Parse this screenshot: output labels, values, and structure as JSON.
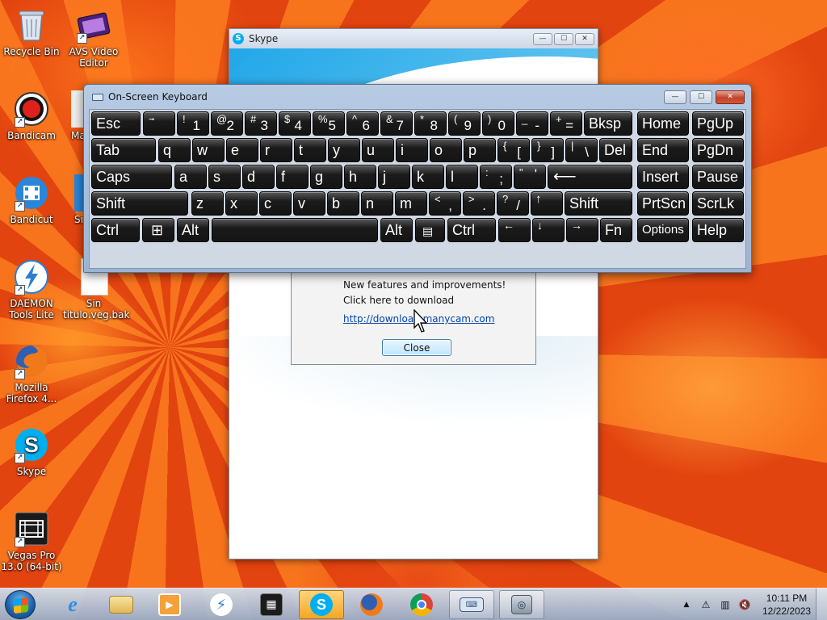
{
  "desktop": {
    "icons": [
      {
        "label": "Recycle Bin",
        "icon": "recycle-bin-icon"
      },
      {
        "label": "AVS Video Editor",
        "icon": "avs-video-editor-icon"
      },
      {
        "label": "Bandicam",
        "icon": "bandicam-icon"
      },
      {
        "label": "Ma",
        "icon": "partial-app-icon"
      },
      {
        "label": "Bandicut",
        "icon": "bandicut-icon"
      },
      {
        "label": "Si",
        "icon": "partial-app-icon"
      },
      {
        "label": "DAEMON Tools Lite",
        "icon": "daemon-tools-icon"
      },
      {
        "label": "Sin titulo.veg.bak",
        "icon": "file-icon"
      },
      {
        "label": "Mozilla Firefox 4...",
        "icon": "firefox-icon"
      },
      {
        "label": "Skype",
        "icon": "skype-icon"
      },
      {
        "label": "Vegas Pro 13.0 (64-bit)",
        "icon": "vegas-pro-icon"
      }
    ]
  },
  "skype_window": {
    "title": "Skype",
    "min": "—",
    "max": "☐",
    "close": "✕"
  },
  "notice": {
    "line1": "New features and improvements!",
    "line2": "Click here to download",
    "link": "http://download.manycam.com",
    "close_label": "Close"
  },
  "osk": {
    "title": "On-Screen Keyboard",
    "min": "—",
    "max": "☐",
    "close": "✕",
    "keys": {
      "esc": "Esc",
      "tilde_s": "~",
      "tilde_m": "`",
      "k1_s": "!",
      "k1_m": "1",
      "k2_s": "@",
      "k2_m": "2",
      "k3_s": "#",
      "k3_m": "3",
      "k4_s": "$",
      "k4_m": "4",
      "k5_s": "%",
      "k5_m": "5",
      "k6_s": "^",
      "k6_m": "6",
      "k7_s": "&",
      "k7_m": "7",
      "k8_s": "*",
      "k8_m": "8",
      "k9_s": "(",
      "k9_m": "9",
      "k0_s": ")",
      "k0_m": "0",
      "minus_s": "_",
      "minus_m": "-",
      "eq_s": "+",
      "eq_m": "=",
      "bksp": "Bksp",
      "home": "Home",
      "pgup": "PgUp",
      "tab": "Tab",
      "q": "q",
      "w": "w",
      "e": "e",
      "r": "r",
      "t": "t",
      "y": "y",
      "u": "u",
      "i": "i",
      "o": "o",
      "p": "p",
      "lbr_s": "{",
      "lbr_m": "[",
      "rbr_s": "}",
      "rbr_m": "]",
      "bsl_s": "|",
      "bsl_m": "\\",
      "del": "Del",
      "end": "End",
      "pgdn": "PgDn",
      "caps": "Caps",
      "a": "a",
      "s": "s",
      "d": "d",
      "f": "f",
      "g": "g",
      "h": "h",
      "j": "j",
      "k": "k",
      "l": "l",
      "semi_s": ":",
      "semi_m": ";",
      "quote_s": "\"",
      "quote_m": "'",
      "enter": "⟵",
      "insert": "Insert",
      "pause": "Pause",
      "shift": "Shift",
      "z": "z",
      "x": "x",
      "c": "c",
      "v": "v",
      "b": "b",
      "n": "n",
      "m": "m",
      "comma_s": "<",
      "comma_m": ",",
      "dot_s": ">",
      "dot_m": ".",
      "slash_s": "?",
      "slash_m": "/",
      "up": "↑",
      "shift_r": "Shift",
      "prtscn": "PrtScn",
      "scrlk": "ScrLk",
      "ctrl": "Ctrl",
      "win": "⊞",
      "alt": "Alt",
      "space": "",
      "alt_r": "Alt",
      "menu": "▤",
      "ctrl_r": "Ctrl",
      "left": "←",
      "down": "↓",
      "right": "→",
      "fn": "Fn",
      "options": "Options",
      "help": "Help"
    }
  },
  "taskbar": {
    "items": [
      "internet-explorer",
      "windows-explorer",
      "media-player",
      "daemon-tools",
      "vegas-pro",
      "skype",
      "firefox",
      "chrome",
      "on-screen-keyboard",
      "manycam"
    ],
    "clock_time": "10:11 PM",
    "clock_date": "12/22/2023",
    "tray_arrow": "▲"
  }
}
